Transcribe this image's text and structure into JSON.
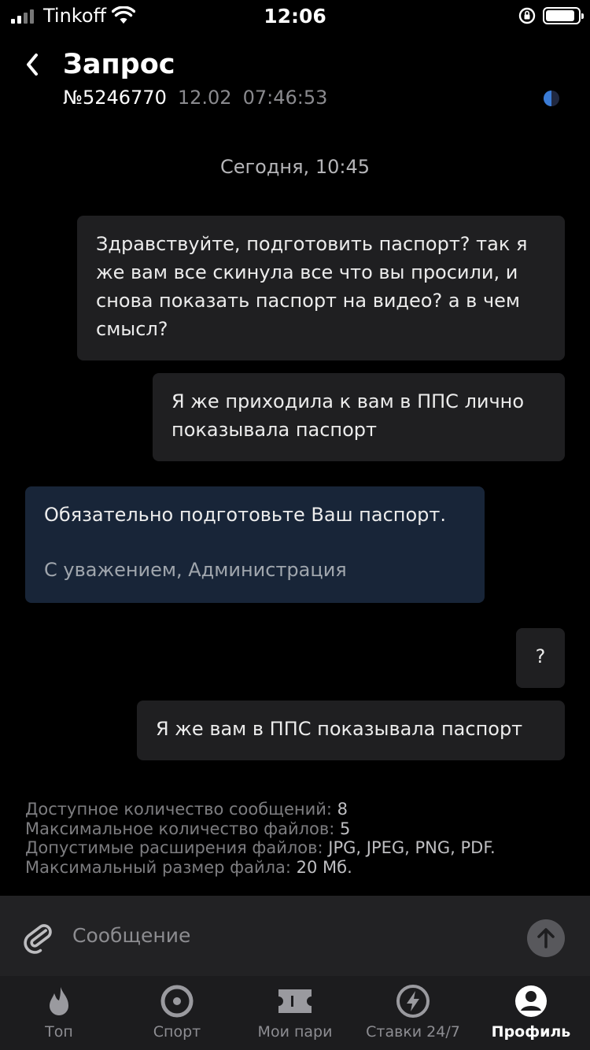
{
  "status_bar": {
    "carrier": "Tinkoff",
    "time": "12:06",
    "signal_bars": 2,
    "battery_level": 0.8
  },
  "header": {
    "title": "Запрос",
    "number": "№5246770",
    "date": "12.02",
    "time": "07:46:53",
    "status_progress": 0.5
  },
  "chat": {
    "day_label": "Сегодня, 10:45",
    "messages": [
      {
        "from": "user",
        "text": "Здравствуйте, подготовить паспорт? так я же вам все скинула все что вы просили, и снова показать паспорт на видео? а в чем смысл?"
      },
      {
        "from": "user",
        "text": "Я же приходила к вам в ППС лично показывала паспорт"
      },
      {
        "from": "admin",
        "text": "Обязательно подготовьте Ваш паспорт.",
        "signature": "С уважением, Администрация"
      },
      {
        "from": "user",
        "text": "?"
      },
      {
        "from": "user",
        "text": "Я же вам в ППС показывала паспорт"
      }
    ]
  },
  "info": {
    "lines": [
      {
        "label": "Доступное количество сообщений: ",
        "value": "8"
      },
      {
        "label": "Максимальное количество файлов: ",
        "value": "5"
      },
      {
        "label": "Допустимые расширения файлов: ",
        "value": "JPG, JPEG, PNG, PDF."
      },
      {
        "label": "Максимальный размер файла: ",
        "value": "20 Мб."
      }
    ]
  },
  "composer": {
    "placeholder": "Сообщение",
    "value": ""
  },
  "tabs": [
    {
      "label": "Топ",
      "icon": "flame-icon",
      "active": false
    },
    {
      "label": "Спорт",
      "icon": "target-icon",
      "active": false
    },
    {
      "label": "Мои пари",
      "icon": "ticket-icon",
      "active": false
    },
    {
      "label": "Ставки 24/7",
      "icon": "lightning-icon",
      "active": false
    },
    {
      "label": "Профиль",
      "icon": "profile-icon",
      "active": true
    }
  ],
  "colors": {
    "background": "#000000",
    "bubble_user": "#1f1f21",
    "bubble_admin": "#182538",
    "accent_blue": "#3a7bd5"
  }
}
